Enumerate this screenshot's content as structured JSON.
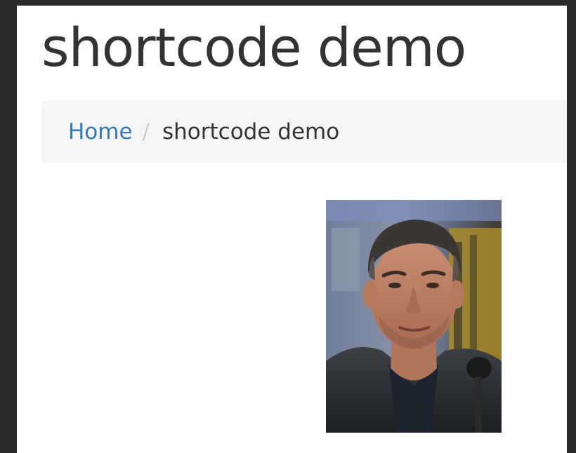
{
  "page": {
    "title": "shortcode demo"
  },
  "breadcrumb": {
    "home_label": "Home",
    "separator": "/",
    "current_label": "shortcode demo"
  },
  "colors": {
    "link": "#337ab7",
    "breadcrumb_bg": "#f5f5f5",
    "text": "#333333",
    "outer_bg": "#2b2b2b"
  }
}
